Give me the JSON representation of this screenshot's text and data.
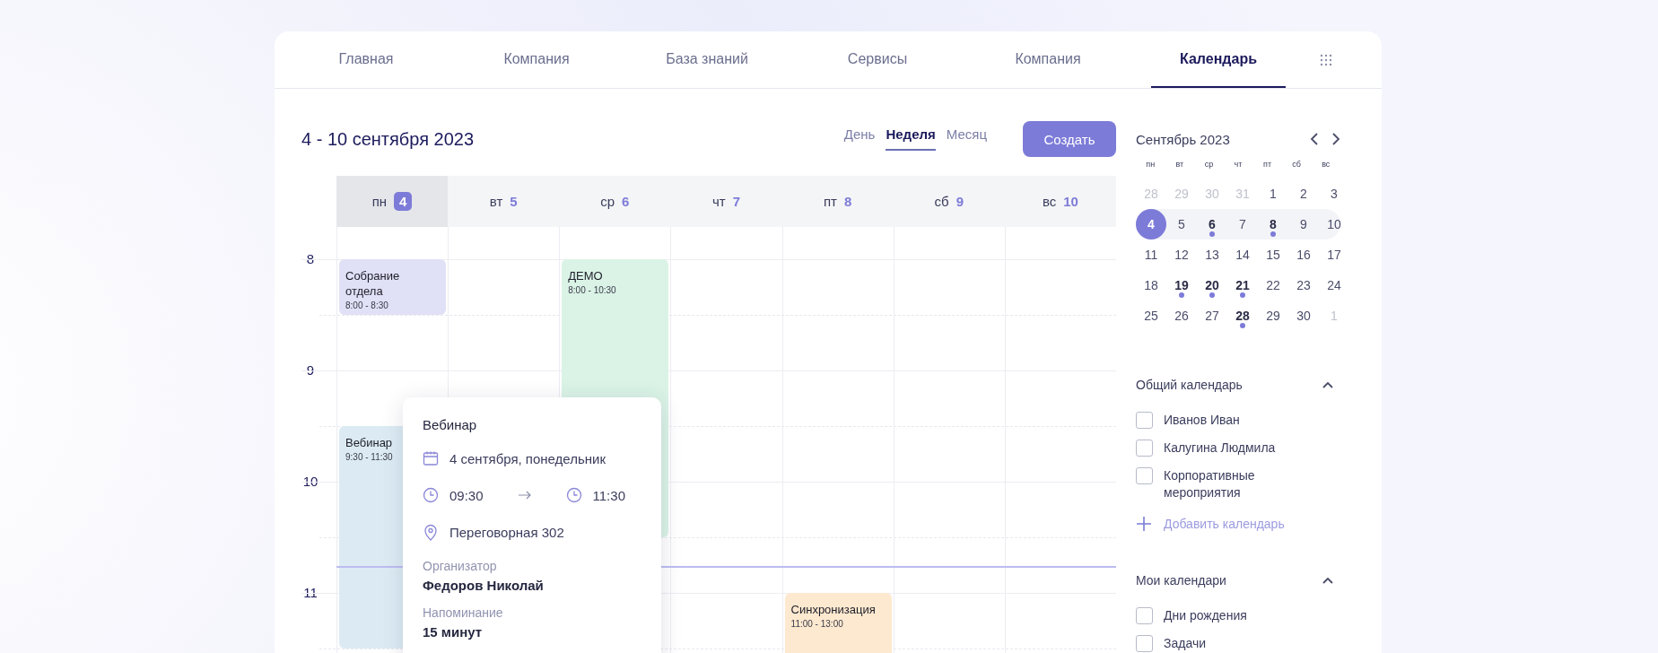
{
  "nav": {
    "tabs": [
      {
        "label": "Главная",
        "selected": false
      },
      {
        "label": "Компания",
        "selected": false
      },
      {
        "label": "База знаний",
        "selected": false
      },
      {
        "label": "Сервисы",
        "selected": false
      },
      {
        "label": "Компания",
        "selected": false
      },
      {
        "label": "Календарь",
        "selected": true
      }
    ]
  },
  "header": {
    "title": "4 - 10 сентября 2023",
    "views": [
      {
        "label": "День",
        "selected": false
      },
      {
        "label": "Неделя",
        "selected": true
      },
      {
        "label": "Месяц",
        "selected": false
      }
    ],
    "create_button": "Создать"
  },
  "week": {
    "hours": [
      "8",
      "9",
      "10",
      "11"
    ],
    "days": [
      {
        "weekday": "пн",
        "date": "4",
        "selected": true,
        "events": [
          {
            "title": "Собрание отдела",
            "time": "8:00 - 8:30",
            "color": "#e0e0f6"
          },
          {
            "title": "Вебинар",
            "time": "9:30 - 11:30",
            "color": "#dcebf3"
          }
        ]
      },
      {
        "weekday": "вт",
        "date": "5",
        "selected": false
      },
      {
        "weekday": "ср",
        "date": "6",
        "selected": false,
        "events": [
          {
            "title": "ДЕМО",
            "time": "8:00 - 10:30",
            "color": "#daf3e6"
          }
        ]
      },
      {
        "weekday": "чт",
        "date": "7",
        "selected": false
      },
      {
        "weekday": "пт",
        "date": "8",
        "selected": false,
        "events": [
          {
            "title": "Синхронизация",
            "time": "11:00 - 13:00",
            "color": "#fde9cf"
          }
        ]
      },
      {
        "weekday": "сб",
        "date": "9",
        "selected": false
      },
      {
        "weekday": "вс",
        "date": "10",
        "selected": false
      }
    ]
  },
  "popup": {
    "title": "Вебинар",
    "date": "4 сентября, понедельник",
    "start": "09:30",
    "end": "11:30",
    "location": "Переговорная 302",
    "fields": [
      {
        "label": "Организатор",
        "value": "Федоров Николай"
      },
      {
        "label": "Напоминание",
        "value": "15 минут"
      }
    ]
  },
  "mini_calendar": {
    "title": "Сентябрь 2023",
    "weekdays": [
      "пн",
      "вт",
      "ср",
      "чт",
      "пт",
      "сб",
      "вс"
    ],
    "weeks": [
      {
        "days": [
          {
            "day": "28",
            "outside": true,
            "has_events": false,
            "selected": false
          },
          {
            "day": "29",
            "outside": true,
            "has_events": false,
            "selected": false
          },
          {
            "day": "30",
            "outside": true,
            "has_events": false,
            "selected": false
          },
          {
            "day": "31",
            "outside": true,
            "has_events": false,
            "selected": false
          },
          {
            "day": "1",
            "outside": false,
            "has_events": false,
            "selected": false
          },
          {
            "day": "2",
            "outside": false,
            "has_events": false,
            "selected": false
          },
          {
            "day": "3",
            "outside": false,
            "has_events": false,
            "selected": false
          }
        ]
      },
      {
        "days": [
          {
            "day": "4",
            "outside": false,
            "has_events": false,
            "selected": true
          },
          {
            "day": "5",
            "outside": false,
            "has_events": false,
            "selected": false
          },
          {
            "day": "6",
            "outside": false,
            "has_events": true,
            "selected": false
          },
          {
            "day": "7",
            "outside": false,
            "has_events": false,
            "selected": false
          },
          {
            "day": "8",
            "outside": false,
            "has_events": true,
            "selected": false
          },
          {
            "day": "9",
            "outside": false,
            "has_events": false,
            "selected": false
          },
          {
            "day": "10",
            "outside": false,
            "has_events": false,
            "selected": false
          }
        ]
      },
      {
        "days": [
          {
            "day": "11",
            "outside": false,
            "has_events": false,
            "selected": false
          },
          {
            "day": "12",
            "outside": false,
            "has_events": false,
            "selected": false
          },
          {
            "day": "13",
            "outside": false,
            "has_events": false,
            "selected": false
          },
          {
            "day": "14",
            "outside": false,
            "has_events": false,
            "selected": false
          },
          {
            "day": "15",
            "outside": false,
            "has_events": false,
            "selected": false
          },
          {
            "day": "16",
            "outside": false,
            "has_events": false,
            "selected": false
          },
          {
            "day": "17",
            "outside": false,
            "has_events": false,
            "selected": false
          }
        ]
      },
      {
        "days": [
          {
            "day": "18",
            "outside": false,
            "has_events": false,
            "selected": false
          },
          {
            "day": "19",
            "outside": false,
            "has_events": true,
            "selected": false
          },
          {
            "day": "20",
            "outside": false,
            "has_events": true,
            "selected": false
          },
          {
            "day": "21",
            "outside": false,
            "has_events": true,
            "selected": false
          },
          {
            "day": "22",
            "outside": false,
            "has_events": false,
            "selected": false
          },
          {
            "day": "23",
            "outside": false,
            "has_events": false,
            "selected": false
          },
          {
            "day": "24",
            "outside": false,
            "has_events": false,
            "selected": false
          }
        ]
      },
      {
        "days": [
          {
            "day": "25",
            "outside": false,
            "has_events": false,
            "selected": false
          },
          {
            "day": "26",
            "outside": false,
            "has_events": false,
            "selected": false
          },
          {
            "day": "27",
            "outside": false,
            "has_events": false,
            "selected": false
          },
          {
            "day": "28",
            "outside": false,
            "has_events": true,
            "selected": false
          },
          {
            "day": "29",
            "outside": false,
            "has_events": false,
            "selected": false
          },
          {
            "day": "30",
            "outside": false,
            "has_events": false,
            "selected": false
          },
          {
            "day": "1",
            "outside": true,
            "has_events": false,
            "selected": false
          }
        ]
      }
    ]
  },
  "calendar_groups": [
    {
      "title": "Общий календарь",
      "expanded": true,
      "items": [
        {
          "label": "Иванов Иван",
          "checked": false
        },
        {
          "label": "Калугина Людмила",
          "checked": false
        },
        {
          "label": "Корпоративные мероприятия",
          "checked": false
        }
      ],
      "add_button": "Добавить календарь"
    },
    {
      "title": "Мои календари",
      "expanded": true,
      "items": [
        {
          "label": "Дни рождения",
          "checked": false
        },
        {
          "label": "Задачи",
          "checked": false
        }
      ]
    }
  ]
}
